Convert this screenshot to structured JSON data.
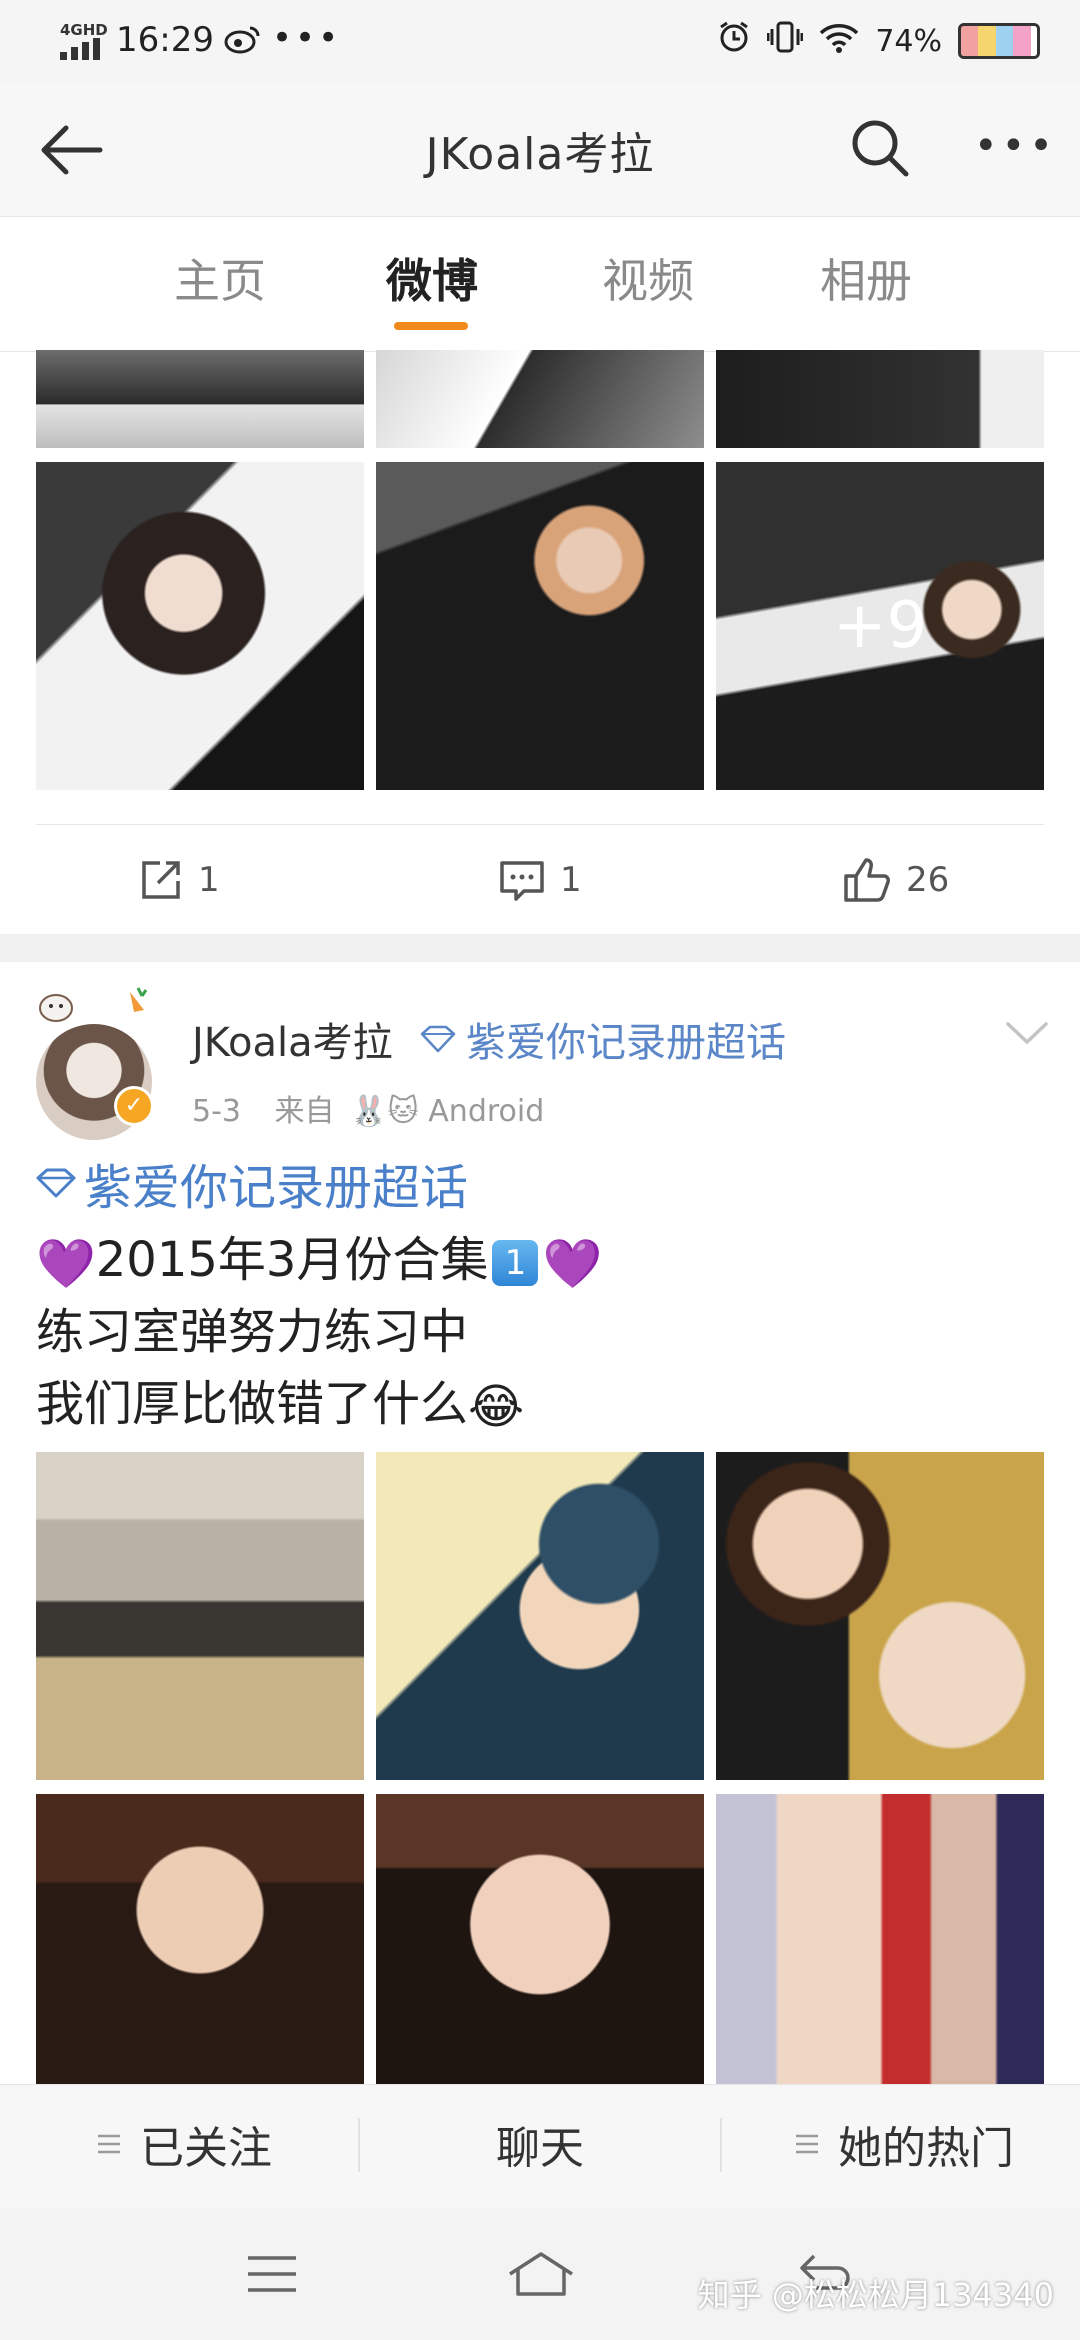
{
  "status_bar": {
    "network": "4GHD",
    "time": "16:29",
    "weibo_icon": "weibo-icon",
    "dots": "•••",
    "battery_percent": "74%",
    "battery_level": 0.74
  },
  "header": {
    "title": "JKoala考拉",
    "back_icon": "arrow-left-icon",
    "search_icon": "search-icon",
    "more_icon": "more-horizontal-icon",
    "more_text": "•••"
  },
  "tabs": [
    {
      "label": "主页",
      "active": false
    },
    {
      "label": "微博",
      "active": true
    },
    {
      "label": "视频",
      "active": false
    },
    {
      "label": "相册",
      "active": false
    }
  ],
  "post1": {
    "more_photos": "+9",
    "actions": {
      "repost_count": "1",
      "comment_count": "1",
      "like_count": "26"
    }
  },
  "post2": {
    "username": "JKoala考拉",
    "topic_inline": "紫爱你记录册超话",
    "date": "5-3",
    "source_prefix": "来自",
    "source": "Android",
    "topic_line": "紫爱你记录册超话",
    "line1_text": "2015年3月份合集",
    "line1_emoji_box": "1",
    "line2": "练习室弹努力练习中",
    "line3": "我们厚比做错了什么",
    "emoji_heart": "💜",
    "emoji_laugh": "😂"
  },
  "bottom_bar": {
    "following": "已关注",
    "chat": "聊天",
    "hot": "她的热门"
  },
  "watermark": "知乎 @松松松月134340",
  "colors": {
    "accent": "#f08a1c",
    "topic_blue": "#4a7fc9",
    "verified": "#f6a623",
    "heart": "#8a3ad0"
  }
}
